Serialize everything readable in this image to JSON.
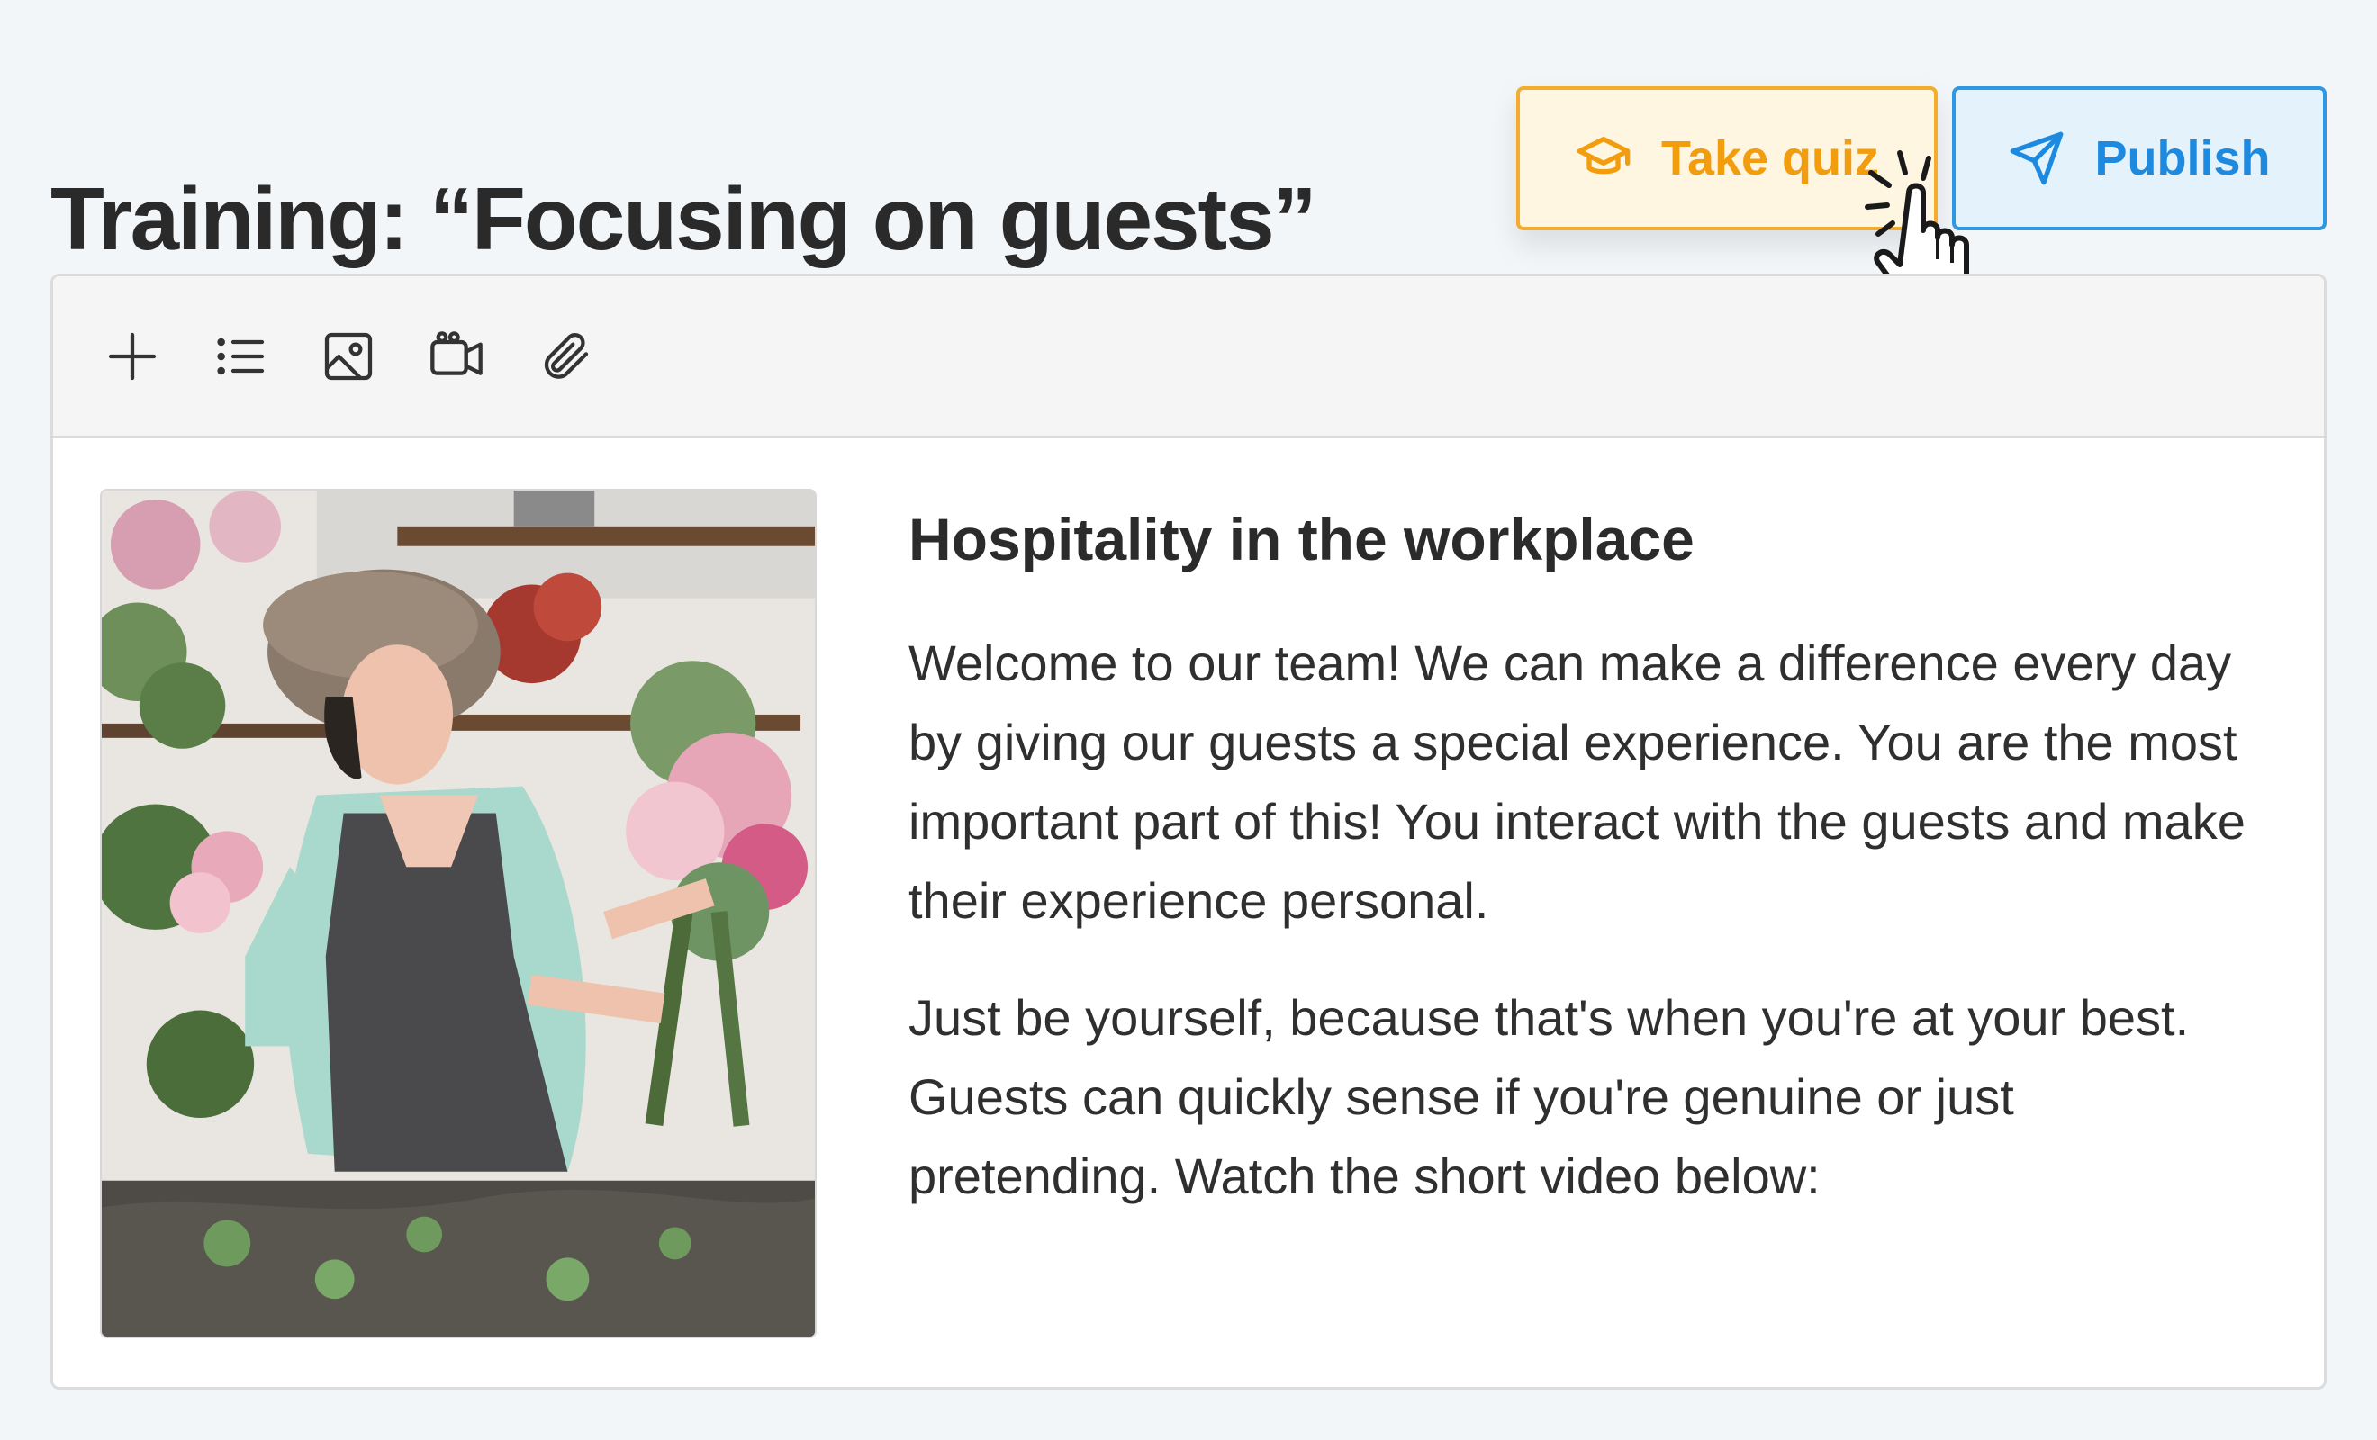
{
  "header": {
    "title": "Training: “Focusing on guests”",
    "take_quiz_label": "Take quiz",
    "publish_label": "Publish"
  },
  "toolbar": {
    "tools": [
      {
        "name": "add-icon"
      },
      {
        "name": "list-icon"
      },
      {
        "name": "image-icon"
      },
      {
        "name": "video-icon"
      },
      {
        "name": "attachment-icon"
      }
    ]
  },
  "content": {
    "heading": "Hospitality in the workplace",
    "paragraph_1": "Welcome to our team! We can make a difference every day by giving our guests a special experience. You are the most important part of this! You interact with the guests and make their experience personal.",
    "paragraph_2": "Just be yourself, because that's when you're at your best. Guests can quickly sense if you're genuine or just pretending. Watch the short video below:"
  },
  "colors": {
    "quiz_accent": "#f29d0e",
    "quiz_bg": "#fff6e2",
    "publish_accent": "#1d8ae0",
    "publish_bg": "#e4f2fc",
    "page_bg": "#f3f6f9"
  }
}
